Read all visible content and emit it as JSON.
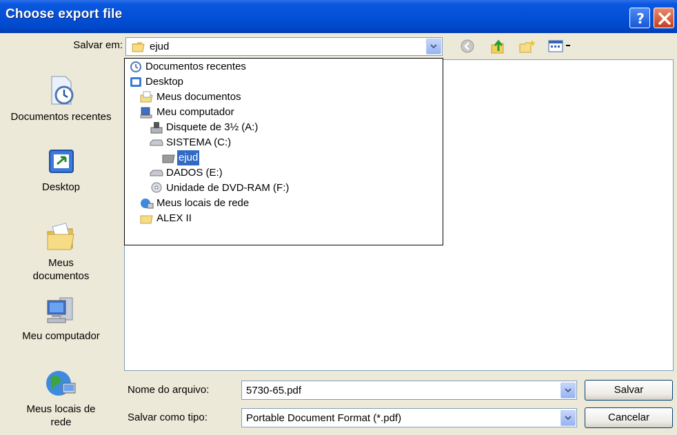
{
  "window": {
    "title": "Choose export file"
  },
  "top": {
    "save_in_label": "Salvar em:",
    "save_in_value": "ejud",
    "toolbar_icons": [
      "back-icon",
      "up-folder-icon",
      "new-folder-icon",
      "view-menu-icon"
    ]
  },
  "places": [
    {
      "label": "Documentos recentes",
      "icon": "recent-documents-icon"
    },
    {
      "label": "Desktop",
      "icon": "desktop-icon"
    },
    {
      "label": "Meus documentos",
      "icon": "my-documents-icon"
    },
    {
      "label": "Meu computador",
      "icon": "my-computer-icon"
    },
    {
      "label": "Meus locais de rede",
      "icon": "network-places-icon"
    }
  ],
  "dropdown": {
    "items": [
      {
        "label": "Documentos recentes",
        "icon": "recent-documents-icon"
      },
      {
        "label": "Desktop",
        "icon": "desktop-icon"
      },
      {
        "label": "Meus documentos",
        "icon": "my-documents-icon"
      },
      {
        "label": "Meu computador",
        "icon": "my-computer-icon"
      },
      {
        "label": "Disquete de 3½ (A:)",
        "icon": "floppy-drive-icon"
      },
      {
        "label": "SISTEMA (C:)",
        "icon": "hard-drive-icon"
      },
      {
        "label": "ejud",
        "icon": "folder-icon",
        "selected": true
      },
      {
        "label": "DADOS (E:)",
        "icon": "hard-drive-icon"
      },
      {
        "label": "Unidade de DVD-RAM (F:)",
        "icon": "dvd-drive-icon"
      },
      {
        "label": "Meus locais de rede",
        "icon": "network-places-icon"
      },
      {
        "label": "ALEX II",
        "icon": "folder-icon"
      }
    ]
  },
  "bottom": {
    "filename_label": "Nome do arquivo:",
    "filename_value": "5730-65.pdf",
    "filetype_label": "Salvar como tipo:",
    "filetype_value": "Portable Document Format (*.pdf)",
    "save_button": "Salvar",
    "cancel_button": "Cancelar"
  },
  "colors": {
    "titlebar": "#0450d7",
    "selection": "#316ac5",
    "dialog_bg": "#ece9d8",
    "field_border": "#7f9db9"
  }
}
